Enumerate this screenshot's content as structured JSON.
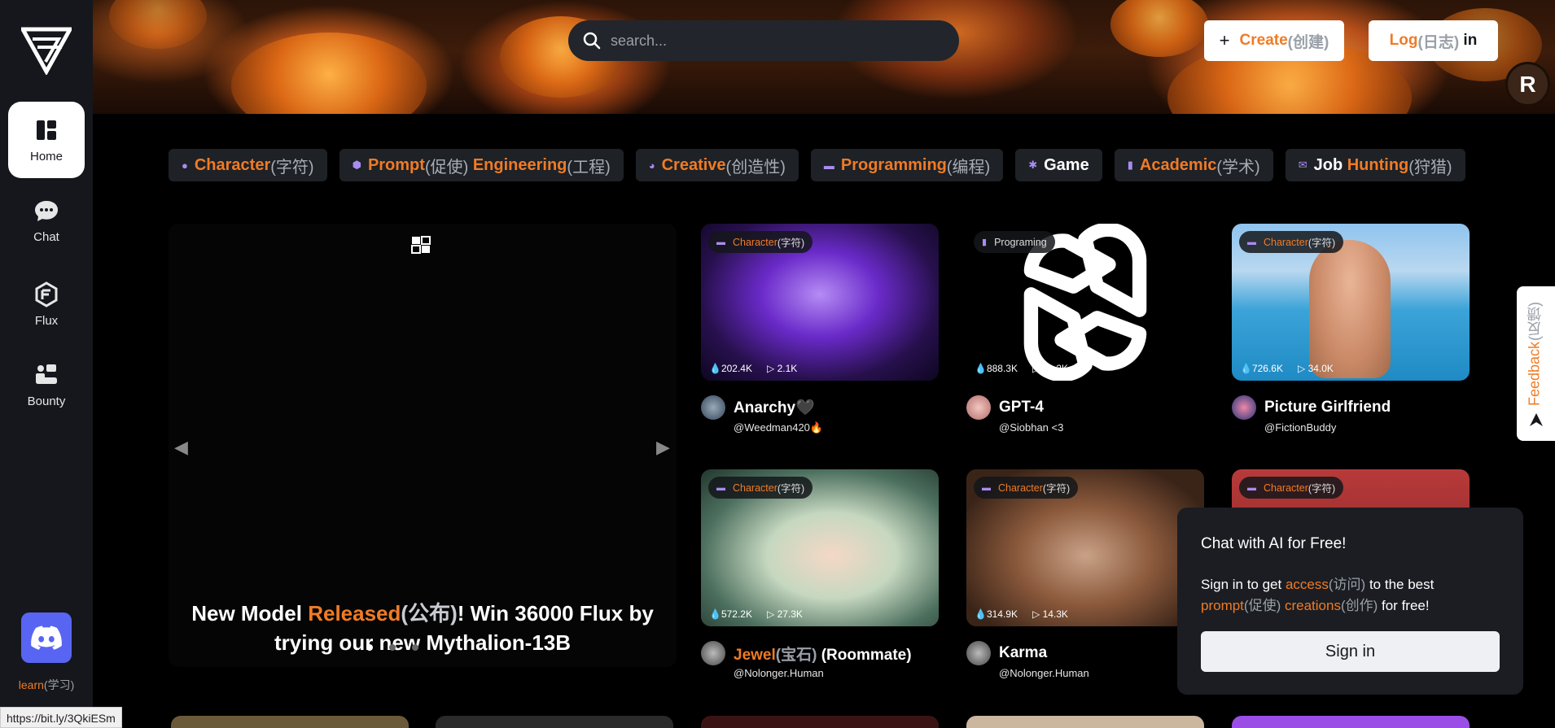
{
  "sidebar": {
    "items": [
      {
        "label": "Home",
        "icon": "home-icon"
      },
      {
        "label": "Chat",
        "icon": "chat-icon"
      },
      {
        "label": "Flux",
        "icon": "flux-icon"
      },
      {
        "label": "Bounty",
        "icon": "bounty-icon"
      }
    ],
    "learn": {
      "word": "learn",
      "translation": "(学习)"
    },
    "status_url": "https://bit.ly/3QkiESm"
  },
  "header": {
    "search_placeholder": "search...",
    "create": {
      "word": "Create",
      "translation": "(创建)"
    },
    "login": {
      "word": "Log",
      "translation": "(日志)",
      "rest": " in"
    },
    "avatar_letter": "R"
  },
  "categories": [
    {
      "parts": [
        {
          "t": "Character",
          "c": "o"
        },
        {
          "t": "(字符)",
          "c": "g"
        }
      ]
    },
    {
      "parts": [
        {
          "t": "Prompt",
          "c": "o"
        },
        {
          "t": "(促使) ",
          "c": "g"
        },
        {
          "t": "Engineering",
          "c": "o"
        },
        {
          "t": "(工程)",
          "c": "g"
        }
      ]
    },
    {
      "parts": [
        {
          "t": "Creative",
          "c": "o"
        },
        {
          "t": "(创造性)",
          "c": "g"
        }
      ]
    },
    {
      "parts": [
        {
          "t": "Programming",
          "c": "o"
        },
        {
          "t": "(编程)",
          "c": "g"
        }
      ]
    },
    {
      "parts": [
        {
          "t": "Game",
          "c": "w"
        }
      ]
    },
    {
      "parts": [
        {
          "t": "Academic",
          "c": "o"
        },
        {
          "t": "(学术)",
          "c": "g"
        }
      ]
    },
    {
      "parts": [
        {
          "t": "Job ",
          "c": "w"
        },
        {
          "t": "Hunting",
          "c": "o"
        },
        {
          "t": "(狩猎)",
          "c": "g"
        }
      ]
    }
  ],
  "carousel": {
    "caption_a": "New Model ",
    "caption_b": "Released",
    "caption_c": "(公布)",
    "caption_d": "! Win 36000 Flux by",
    "caption_e": "trying our new Mythalion-13B"
  },
  "cards": [
    {
      "tag_word": "Character",
      "tag_tr": "(字符)",
      "likes": "202.4K",
      "plays": "2.1K",
      "name": "Anarchy🖤",
      "author": "@Weedman420🔥"
    },
    {
      "tag_word": "Programing",
      "tag_tr": "",
      "likes": "888.3K",
      "plays": "41.2K",
      "name": "GPT-4",
      "author": "@Siobhan <3"
    },
    {
      "tag_word": "Character",
      "tag_tr": "(字符)",
      "likes": "726.6K",
      "plays": "34.0K",
      "name": "Picture Girlfriend",
      "author": "@FictionBuddy"
    },
    {
      "tag_word": "Character",
      "tag_tr": "(字符)",
      "likes": "572.2K",
      "plays": "27.3K",
      "name_a": "Jewel",
      "name_b": "(宝石)",
      "name_c": " (Roommate)",
      "author": "@Nolonger.Human"
    },
    {
      "tag_word": "Character",
      "tag_tr": "(字符)",
      "likes": "314.9K",
      "plays": "14.3K",
      "name": "Karma",
      "author": "@Nolonger.Human"
    },
    {
      "tag_word": "Character",
      "tag_tr": "(字符)"
    }
  ],
  "popup": {
    "title": "Chat with AI for Free!",
    "b1": "Sign in to get ",
    "b2": "access",
    "b3": "(访问)",
    "b4": " to the best",
    "b5": "prompt",
    "b6": "(促使) ",
    "b7": "creations",
    "b8": "(创作)",
    "b9": " for free!",
    "button": "Sign in"
  },
  "feedback": {
    "word": "Feedback",
    "translation": "(反馈)"
  },
  "colors": {
    "accent": "#f07b25",
    "sidebar": "#15171c",
    "discord": "#5865f2"
  }
}
